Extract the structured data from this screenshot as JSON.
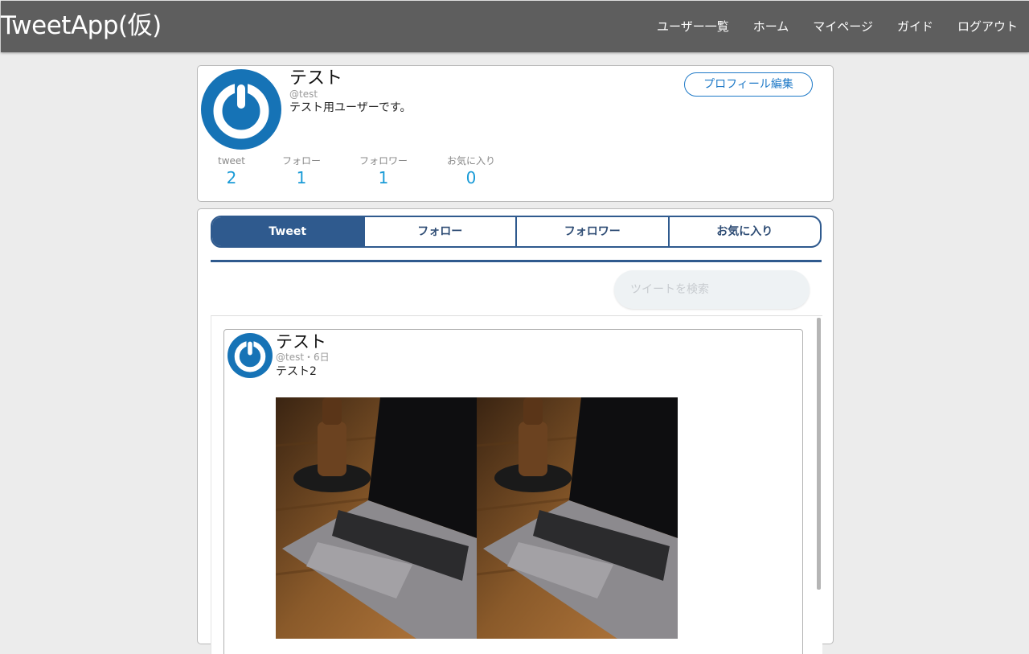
{
  "header": {
    "brand": "TweetApp(仮)",
    "nav": [
      "ユーザー一覧",
      "ホーム",
      "マイページ",
      "ガイド",
      "ログアウト"
    ]
  },
  "profile": {
    "name": "テスト",
    "handle": "@test",
    "bio": "テスト用ユーザーです。",
    "edit_label": "プロフィール編集",
    "stats": [
      {
        "label": "tweet",
        "value": "2"
      },
      {
        "label": "フォロー",
        "value": "1"
      },
      {
        "label": "フォロワー",
        "value": "1"
      },
      {
        "label": "お気に入り",
        "value": "0"
      }
    ]
  },
  "tabs": [
    {
      "label": "Tweet",
      "active": true
    },
    {
      "label": "フォロー",
      "active": false
    },
    {
      "label": "フォロワー",
      "active": false
    },
    {
      "label": "お気に入り",
      "active": false
    }
  ],
  "search": {
    "placeholder": "ツイートを検索"
  },
  "tweet": {
    "name": "テスト",
    "meta": "@test・6日",
    "text": "テスト2"
  },
  "colors": {
    "navbar": "#5e5e5e",
    "accent_blue": "#1e79c7",
    "tab_navy": "#2f5a8e",
    "stat_blue": "#1a9bd7"
  },
  "icons": {
    "avatar": "power-button-icon",
    "tweet_image": "laptop-photo"
  }
}
